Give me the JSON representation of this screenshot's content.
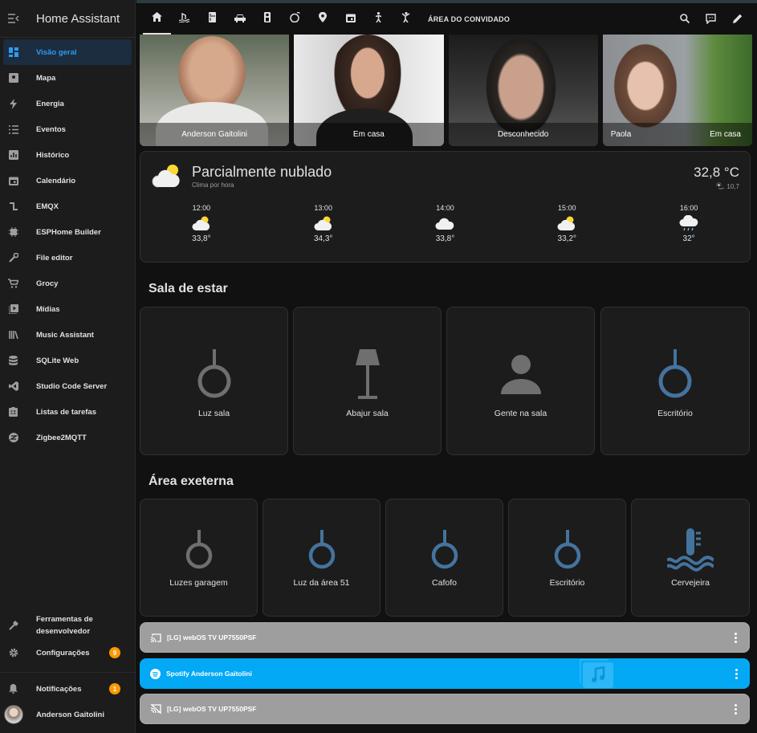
{
  "app": {
    "title": "Home Assistant"
  },
  "colors": {
    "accent": "#2f9bf0",
    "badge": "#ff9800",
    "spotify": "#03a9f4",
    "light_on": "#44739e",
    "light_off": "#6f6f6f"
  },
  "sidebar": {
    "items": [
      {
        "label": "Visão geral",
        "icon": "dashboard-icon"
      },
      {
        "label": "Mapa",
        "icon": "map-icon"
      },
      {
        "label": "Energia",
        "icon": "energy-icon"
      },
      {
        "label": "Eventos",
        "icon": "list-icon"
      },
      {
        "label": "Histórico",
        "icon": "chart-icon"
      },
      {
        "label": "Calendário",
        "icon": "calendar-icon"
      },
      {
        "label": "EMQX",
        "icon": "emqx-icon"
      },
      {
        "label": "ESPHome Builder",
        "icon": "chip-icon"
      },
      {
        "label": "File editor",
        "icon": "wrench-icon"
      },
      {
        "label": "Grocy",
        "icon": "cart-icon"
      },
      {
        "label": "Mídias",
        "icon": "media-icon"
      },
      {
        "label": "Music Assistant",
        "icon": "library-icon"
      },
      {
        "label": "SQLite Web",
        "icon": "database-icon"
      },
      {
        "label": "Studio Code Server",
        "icon": "vscode-icon"
      },
      {
        "label": "Listas de tarefas",
        "icon": "clipboard-icon"
      },
      {
        "label": "Zigbee2MQTT",
        "icon": "zigbee-icon"
      }
    ],
    "dev_tools": "Ferramentas de desenvolvedor",
    "settings": "Configurações",
    "settings_badge": "9",
    "notifications": "Notificações",
    "notifications_badge": "1",
    "user": "Anderson Gaitolini"
  },
  "topbar": {
    "tab_icons": [
      "home-icon",
      "pool-icon",
      "fridge-icon",
      "car-icon",
      "remote-icon",
      "washing-machine-icon",
      "location-icon",
      "calendar-icon",
      "person-walk-icon",
      "person-stretch-icon"
    ],
    "guest_area": "ÁREA DO CONVIDADO",
    "actions": [
      "search-icon",
      "assist-icon",
      "edit-icon"
    ]
  },
  "persons": [
    {
      "name": "Anderson Gaitolini",
      "state": ""
    },
    {
      "name": "",
      "state": "Em casa"
    },
    {
      "name": "",
      "state": "Desconhecido"
    },
    {
      "name": "Paola",
      "state": "Em casa"
    }
  ],
  "weather": {
    "state": "Parcialmente nublado",
    "name": "Clima por hora",
    "temperature": "32,8 °C",
    "attribute": "10,7",
    "forecast": [
      {
        "time": "12:00",
        "temp": "33,8°",
        "icon": "partly-cloudy-icon"
      },
      {
        "time": "13:00",
        "temp": "34,3°",
        "icon": "partly-cloudy-icon"
      },
      {
        "time": "14:00",
        "temp": "33,8°",
        "icon": "cloudy-icon"
      },
      {
        "time": "15:00",
        "temp": "33,2°",
        "icon": "partly-cloudy-icon"
      },
      {
        "time": "16:00",
        "temp": "32°",
        "icon": "rainy-icon"
      }
    ]
  },
  "sala": {
    "title": "Sala de estar",
    "tiles": [
      {
        "name": "Luz sala",
        "icon": "ceiling-light-icon",
        "on": false
      },
      {
        "name": "Abajur sala",
        "icon": "floor-lamp-icon",
        "on": false
      },
      {
        "name": "Gente na sala",
        "icon": "account-icon",
        "on": false
      },
      {
        "name": "Escritório",
        "icon": "ceiling-light-icon",
        "on": true
      }
    ]
  },
  "externa": {
    "title": "Área exeterna",
    "tiles": [
      {
        "name": "Luzes garagem",
        "icon": "ceiling-light-icon",
        "on": false
      },
      {
        "name": "Luz da área 51",
        "icon": "ceiling-light-icon",
        "on": true
      },
      {
        "name": "Cafofo",
        "icon": "ceiling-light-icon",
        "on": true
      },
      {
        "name": "Escritório",
        "icon": "ceiling-light-icon",
        "on": true
      },
      {
        "name": "Cervejeira",
        "icon": "thermometer-water-icon",
        "on": true
      }
    ]
  },
  "media": [
    {
      "name": "[LG] webOS TV UP7550PSF",
      "icon": "cast-icon"
    },
    {
      "name": "Spotify Anderson Gaitolini",
      "icon": "spotify-icon"
    },
    {
      "name": "[LG] webOS TV UP7550PSF",
      "icon": "cast-off-icon"
    }
  ]
}
